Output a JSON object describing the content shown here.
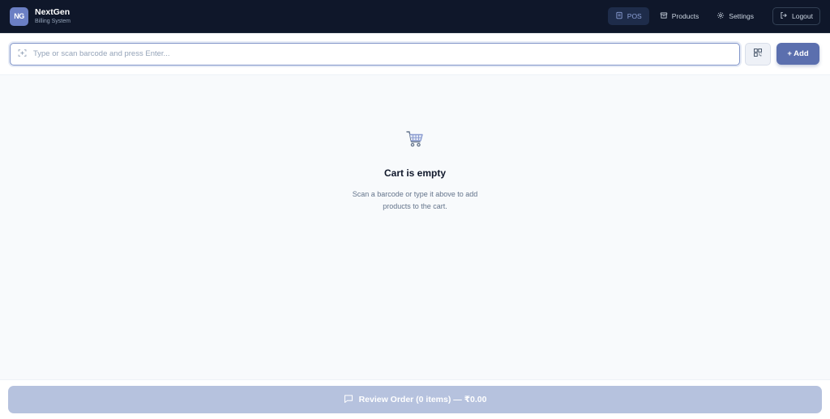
{
  "brand": {
    "logo_text": "NG",
    "name": "NextGen",
    "subtitle": "Billing System"
  },
  "nav": {
    "items": [
      {
        "label": "POS",
        "icon": "receipt-icon",
        "active": true
      },
      {
        "label": "Products",
        "icon": "archive-box-icon",
        "active": false
      },
      {
        "label": "Settings",
        "icon": "gear-icon",
        "active": false
      }
    ],
    "logout_label": "Logout"
  },
  "search": {
    "placeholder": "Type or scan barcode and press Enter...",
    "value": "",
    "add_label": "+ Add"
  },
  "cart": {
    "empty_title": "Cart is empty",
    "empty_description": "Scan a barcode or type it above to add products to the cart."
  },
  "footer": {
    "review_label": "Review Order (0 items) — ₹0.00"
  },
  "colors": {
    "topbar_bg": "#0f172a",
    "accent": "#5b6fae",
    "review_button_disabled": "#b6c2de"
  }
}
